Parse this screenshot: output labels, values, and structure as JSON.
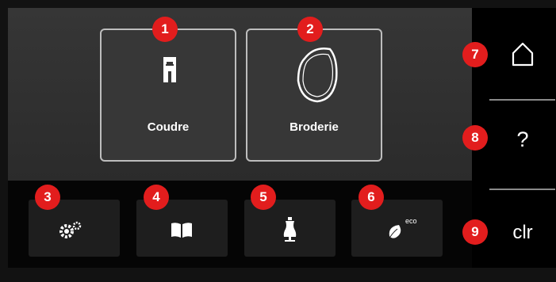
{
  "modes": {
    "sewing": {
      "label": "Coudre",
      "icon": "presser-foot-icon"
    },
    "embroidery": {
      "label": "Broderie",
      "icon": "embroidery-hoop-icon"
    }
  },
  "toolbar": [
    {
      "icon": "gears-icon"
    },
    {
      "icon": "open-book-icon"
    },
    {
      "icon": "dress-form-icon"
    },
    {
      "icon": "eco-leaf-icon",
      "text": "eco"
    }
  ],
  "side": {
    "home": {
      "icon": "home-icon"
    },
    "help": {
      "label": "?",
      "icon": "question-icon"
    },
    "clear": {
      "label": "clr"
    }
  },
  "callouts": [
    "1",
    "2",
    "3",
    "4",
    "5",
    "6",
    "7",
    "8",
    "9"
  ],
  "colors": {
    "callout": "#e21d1d",
    "tile_border": "#bdbdbd",
    "background": "#121212"
  }
}
